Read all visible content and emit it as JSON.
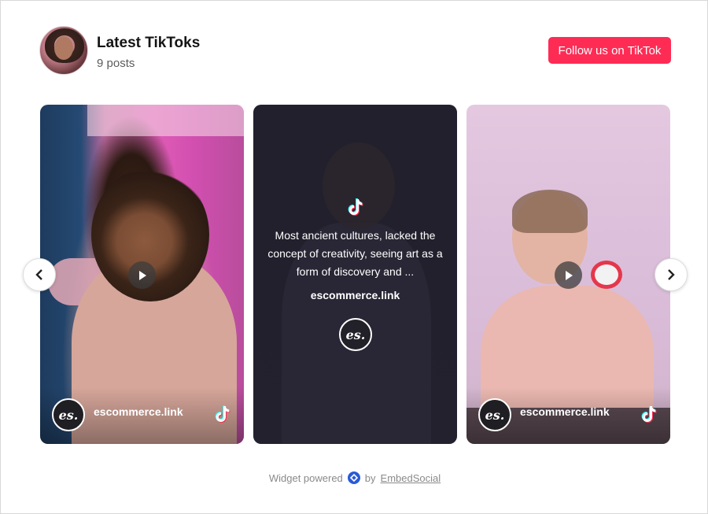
{
  "header": {
    "title": "Latest TikToks",
    "posts_count": "9 posts",
    "follow_label": "Follow us on TikTok"
  },
  "cards": [
    {
      "handle": "escommerce.link",
      "badge": "es."
    },
    {
      "caption": "Most ancient cultures, lacked the concept of creativity, seeing art as a form of discovery and ...",
      "link": "escommerce.link",
      "badge": "es."
    },
    {
      "handle": "escommerce.link",
      "badge": "es."
    }
  ],
  "footer": {
    "powered_text": "Widget powered",
    "by_text": "by",
    "brand_link": "EmbedSocial"
  },
  "colors": {
    "accent": "#fe2c55",
    "embedsocial_blue": "#2a5ad8"
  },
  "icons": [
    "tiktok-icon",
    "play-icon",
    "chevron-left-icon",
    "chevron-right-icon",
    "embedsocial-icon"
  ]
}
